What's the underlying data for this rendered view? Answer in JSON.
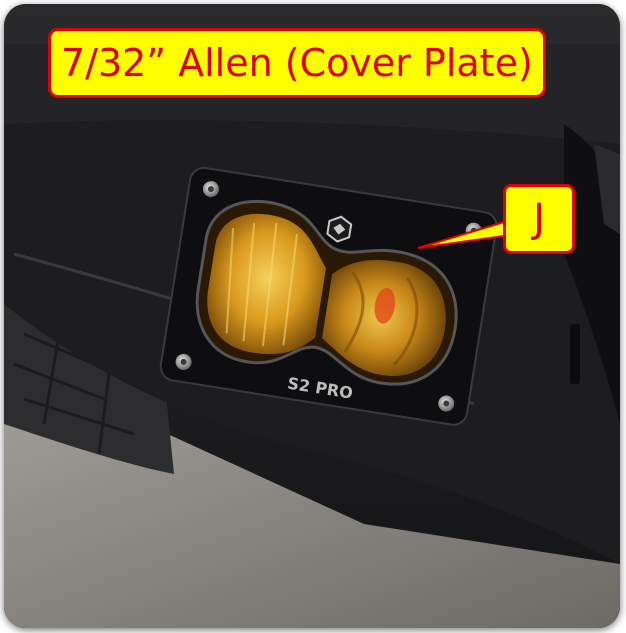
{
  "labels": {
    "title": "7/32” Allen (Cover Plate)",
    "callout": "J"
  },
  "light_logo": "S2 PRO",
  "colors": {
    "label_fill": "#ffff00",
    "label_border": "#e00000",
    "label_text": "#e00000",
    "lens_amber": "#d99a1c",
    "bumper": "#1d1d1f"
  },
  "icons": {
    "bolts": "allen-bolt-icon",
    "logo": "brand-logo-icon"
  }
}
